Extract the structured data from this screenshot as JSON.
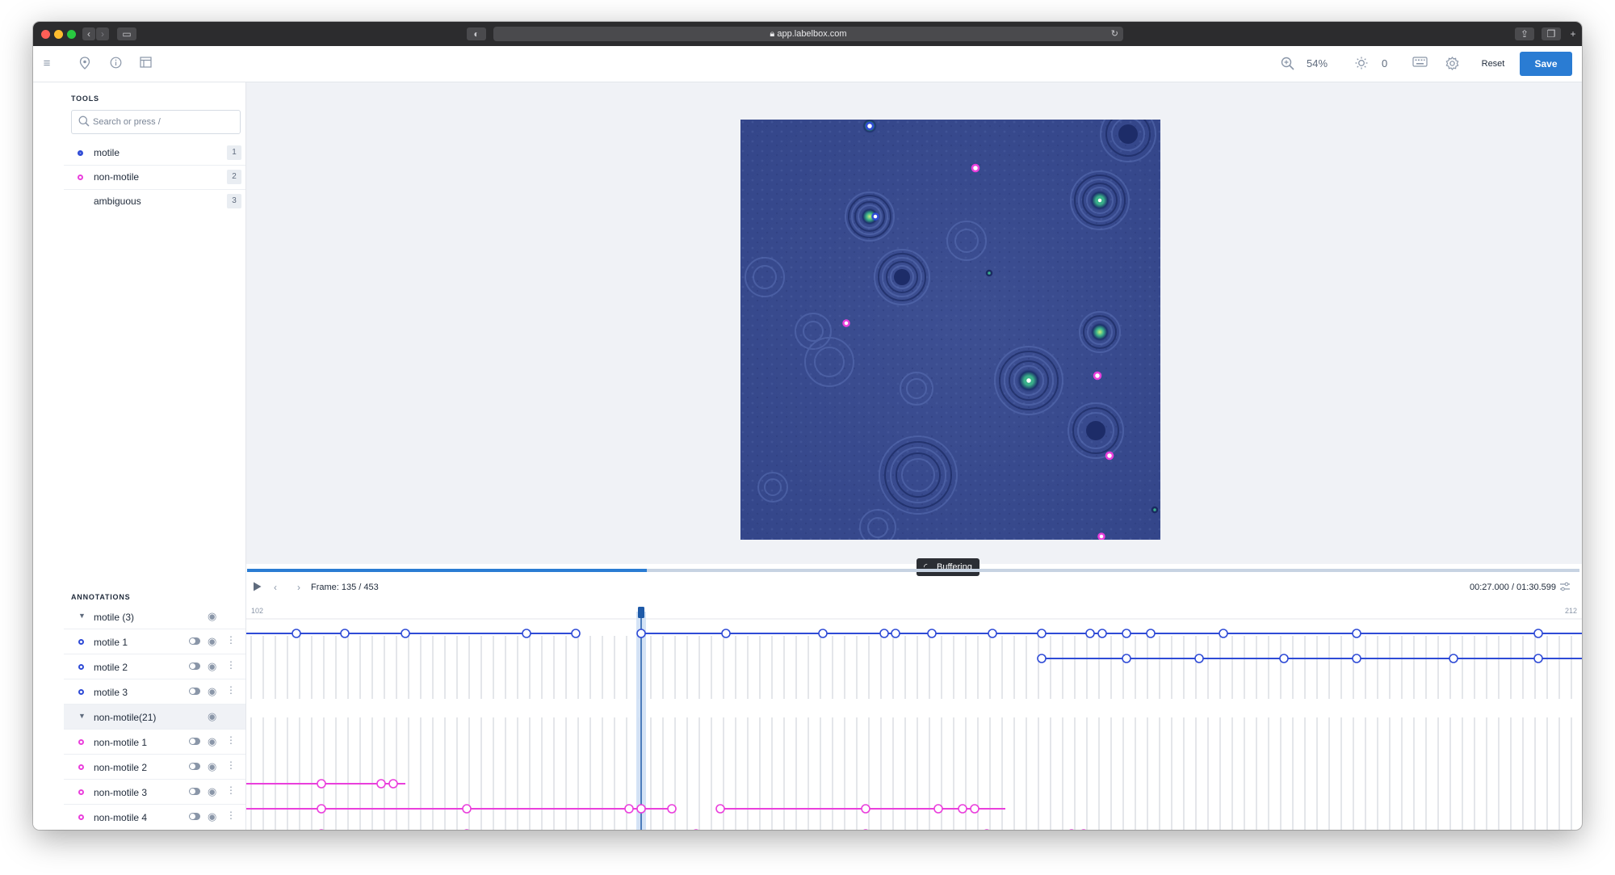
{
  "browser": {
    "url": "app.labelbox.com",
    "colors": {
      "close": "#ff5f57",
      "minimize": "#febc2e",
      "maximize": "#28c840"
    }
  },
  "header": {
    "icons": [
      "menu-icon",
      "pin-icon",
      "info-icon",
      "layout-icon",
      "zoom-icon",
      "brightness-icon",
      "keyboard-icon",
      "settings-icon"
    ],
    "zoom": "54%",
    "brightness": "0",
    "reset_label": "Reset",
    "save_label": "Save",
    "accent": "#2a7cd3"
  },
  "tools": {
    "title": "TOOLS",
    "search_placeholder": "Search or press /",
    "items": [
      {
        "label": "motile",
        "key": "1",
        "color": "#2f4bd6"
      },
      {
        "label": "non-motile",
        "key": "2",
        "color": "#ea3fdc"
      },
      {
        "label": "ambiguous",
        "key": "3",
        "color": ""
      }
    ]
  },
  "canvas": {
    "buffering_label": "Buffering"
  },
  "player": {
    "progress": 0.3,
    "frame_text": "Frame: 135  / 453",
    "time_text": "00:27.000 / 01:30.599",
    "range_start": "102",
    "range_end": "212"
  },
  "annotations": {
    "title": "ANNOTATIONS",
    "groups": [
      {
        "label": "motile (3)",
        "color": "#2f4bd6",
        "items": [
          "motile 1",
          "motile 2",
          "motile 3"
        ]
      },
      {
        "label": "non-motile(21)",
        "color": "#ea3fdc",
        "items": [
          "non-motile 1",
          "non-motile 2",
          "non-motile 3",
          "non-motile 4"
        ]
      }
    ]
  }
}
